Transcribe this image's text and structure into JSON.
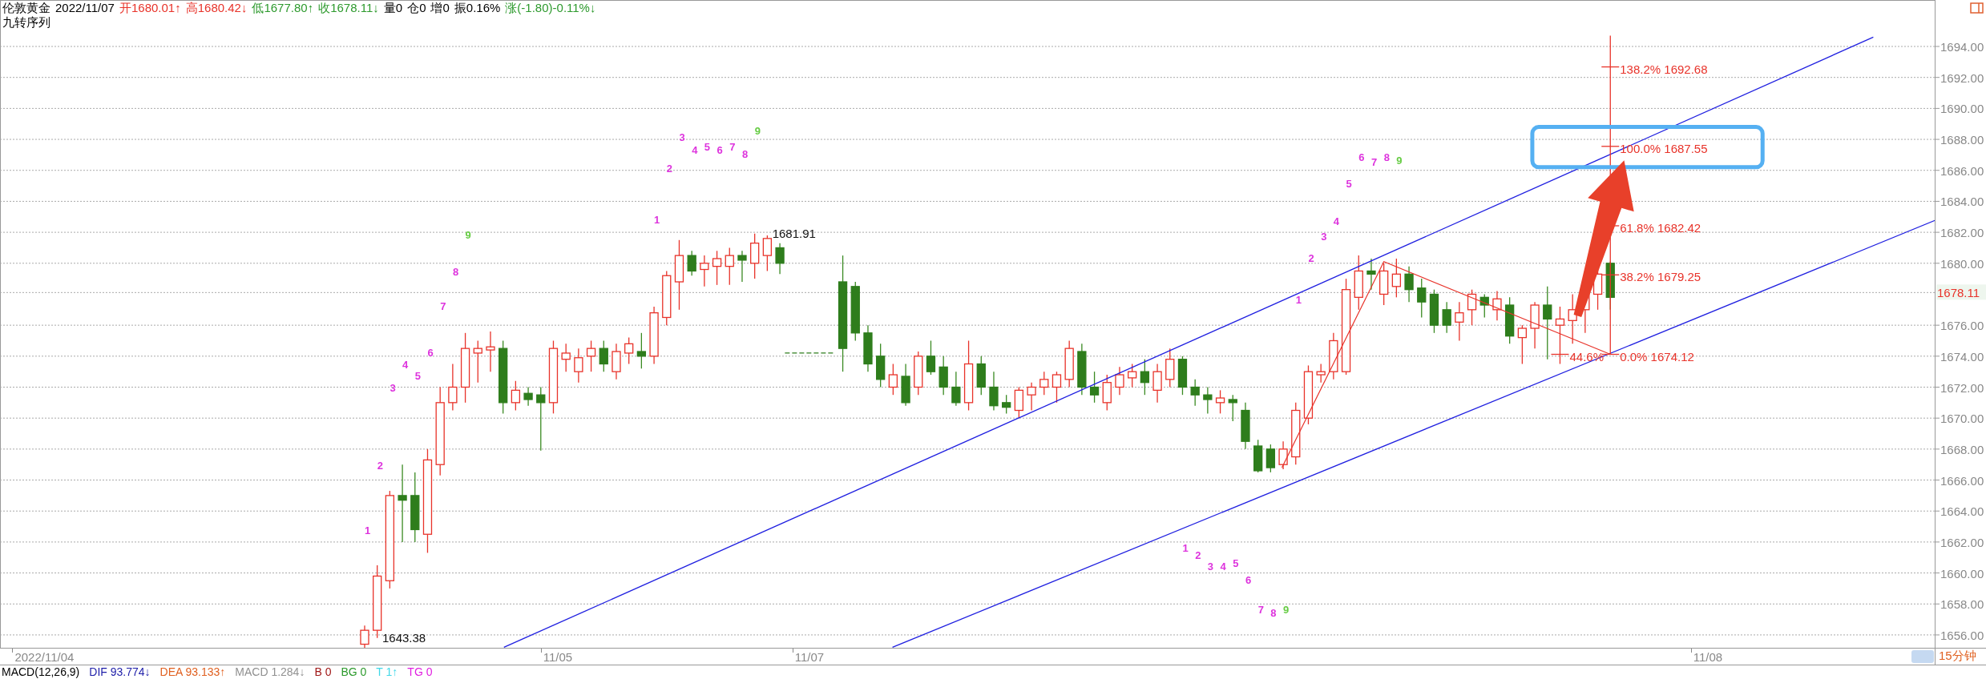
{
  "quote_bar": {
    "items": [
      {
        "text": "伦敦黄金"
      },
      {
        "text": "2022/11/07"
      },
      {
        "text": "开1680.01↑",
        "color": "#e8332a"
      },
      {
        "text": "高1680.42↓",
        "color": "#e8332a"
      },
      {
        "text": "低1677.80↑",
        "color": "#2e9a2e"
      },
      {
        "text": "收1678.11↓",
        "color": "#2e9a2e"
      },
      {
        "text": "量0"
      },
      {
        "text": "仓0"
      },
      {
        "text": "增0"
      },
      {
        "text": "振0.16%"
      },
      {
        "text": "涨(-1.80)-0.11%↓",
        "color": "#2e9a2e"
      }
    ],
    "indicator_title": "九转序列"
  },
  "chart": {
    "price_scale": [
      "1694.00",
      "1692.00",
      "1690.00",
      "1688.00",
      "1686.00",
      "1684.00",
      "1682.00",
      "1680.00",
      "1676.00",
      "1674.00",
      "1672.00",
      "1670.00",
      "1668.00",
      "1666.00",
      "1664.00",
      "1662.00",
      "1660.00",
      "1658.00",
      "1656.00"
    ],
    "current_price": "1678.11",
    "date_labels": [
      "2022/11/04",
      "11/05",
      "11/07",
      "11/08"
    ],
    "price_marks": [
      "1681.91",
      "1643.38"
    ],
    "fib_levels": [
      "138.2% 1692.68",
      "100.0% 1687.55",
      "61.8% 1682.42",
      "38.2% 1679.25",
      "44.6%",
      "0.0% 1674.12"
    ],
    "sequence_numbers": [
      {
        "text": "1",
        "color": "#dd33dd"
      },
      {
        "text": "2",
        "color": "#dd33dd"
      },
      {
        "text": "3",
        "color": "#dd33dd"
      },
      {
        "text": "4",
        "color": "#dd33dd"
      },
      {
        "text": "5",
        "color": "#dd33dd"
      },
      {
        "text": "6",
        "color": "#dd33dd"
      },
      {
        "text": "7",
        "color": "#dd33dd"
      },
      {
        "text": "8",
        "color": "#dd33dd"
      },
      {
        "text": "9",
        "color": "#66cc44"
      },
      {
        "text": "1",
        "color": "#dd33dd"
      },
      {
        "text": "2",
        "color": "#dd33dd"
      },
      {
        "text": "3",
        "color": "#dd33dd"
      },
      {
        "text": "4",
        "color": "#dd33dd"
      },
      {
        "text": "5",
        "color": "#dd33dd"
      },
      {
        "text": "6",
        "color": "#dd33dd"
      },
      {
        "text": "7",
        "color": "#dd33dd"
      },
      {
        "text": "8",
        "color": "#dd33dd"
      },
      {
        "text": "9",
        "color": "#66cc44"
      },
      {
        "text": "1",
        "color": "#dd33dd"
      },
      {
        "text": "2",
        "color": "#dd33dd"
      },
      {
        "text": "3",
        "color": "#dd33dd"
      },
      {
        "text": "4",
        "color": "#dd33dd"
      },
      {
        "text": "5",
        "color": "#dd33dd"
      },
      {
        "text": "6",
        "color": "#dd33dd"
      },
      {
        "text": "7",
        "color": "#dd33dd"
      },
      {
        "text": "8",
        "color": "#dd33dd"
      },
      {
        "text": "9",
        "color": "#66cc44"
      },
      {
        "text": "1",
        "color": "#dd33dd"
      },
      {
        "text": "2",
        "color": "#dd33dd"
      },
      {
        "text": "3",
        "color": "#dd33dd"
      },
      {
        "text": "4",
        "color": "#dd33dd"
      },
      {
        "text": "5",
        "color": "#dd33dd"
      },
      {
        "text": "6",
        "color": "#dd33dd"
      },
      {
        "text": "7",
        "color": "#dd33dd"
      },
      {
        "text": "8",
        "color": "#dd33dd"
      },
      {
        "text": "9",
        "color": "#66cc44"
      }
    ]
  },
  "period": "15分钟",
  "macd_bar": {
    "items": [
      {
        "text": "MACD(12,26,9)"
      },
      {
        "text": "DIF 93.774↓",
        "color": "#1c1ca8"
      },
      {
        "text": "DEA 93.133↑",
        "color": "#e06020"
      },
      {
        "text": "MACD 1.284↓",
        "color": "#909090"
      },
      {
        "text": "B 0",
        "color": "#a01818"
      },
      {
        "text": "BG 0",
        "color": "#2c9a2c"
      },
      {
        "text": "T 1↑",
        "color": "#40d8e8"
      },
      {
        "text": "TG 0",
        "color": "#e020e0"
      }
    ]
  }
}
